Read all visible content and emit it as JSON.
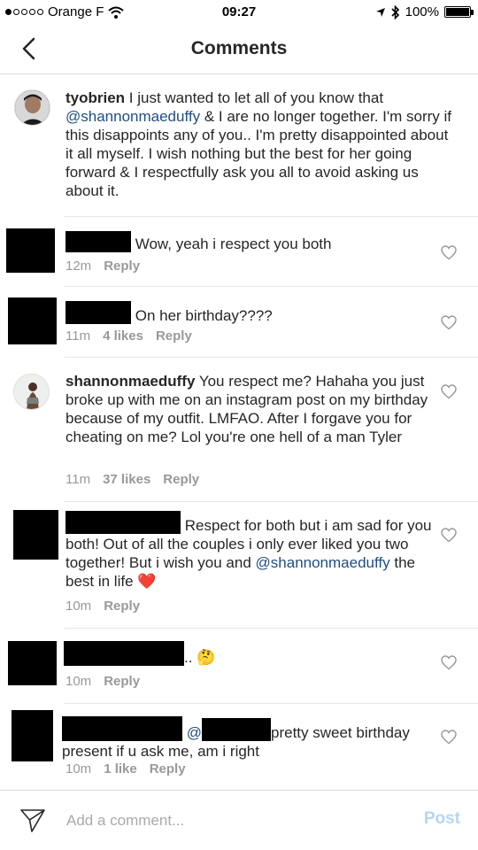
{
  "status": {
    "carrier": "Orange F",
    "time": "09:27",
    "battery": "100%"
  },
  "nav": {
    "title": "Comments"
  },
  "caption": {
    "username": "tyobrien",
    "text_1": " I just wanted to let all of you know that",
    "mention": "@shannonmaeduffy",
    "text_2": " & I are no longer together. I'm sorry if this disappoints any of you.. I'm pretty disappointed about it all myself. I wish nothing but the best for her going forward & I respectfully ask you all to avoid asking us about it."
  },
  "comments": [
    {
      "text": "Wow, yeah i respect you both",
      "time": "12m",
      "reply": "Reply"
    },
    {
      "text": "On her birthday????",
      "time": "11m",
      "likes": "4 likes",
      "reply": "Reply"
    },
    {
      "username": "shannonmaeduffy",
      "text": " You respect me? Hahaha you just broke up with me on an instagram post on my birthday because of my outfit. LMFAO. After I forgave you for cheating on me? Lol you're one hell of a man Tyler",
      "time": "11m",
      "likes": "37 likes",
      "reply": "Reply"
    },
    {
      "text_1": "Respect for both but i am sad for you both! Out of all the couples i only ever liked you two together! But i wish you and ",
      "mention": "@shannonmaeduffy",
      "text_2": " the best in life ",
      "emoji": "❤️",
      "time": "10m",
      "reply": "Reply"
    },
    {
      "text": "..",
      "emoji": "🤔",
      "time": "10m",
      "reply": "Reply"
    },
    {
      "prefix": "@",
      "text": "pretty sweet birthday present if u ask me, am i right",
      "time": "10m",
      "likes": "1 like",
      "reply": "Reply"
    }
  ],
  "composer": {
    "placeholder": "Add a comment...",
    "post_label": "Post"
  },
  "colors": {
    "mention": "#1f4e86",
    "meta": "#999999",
    "post_disabled": "#b3d7f5"
  }
}
